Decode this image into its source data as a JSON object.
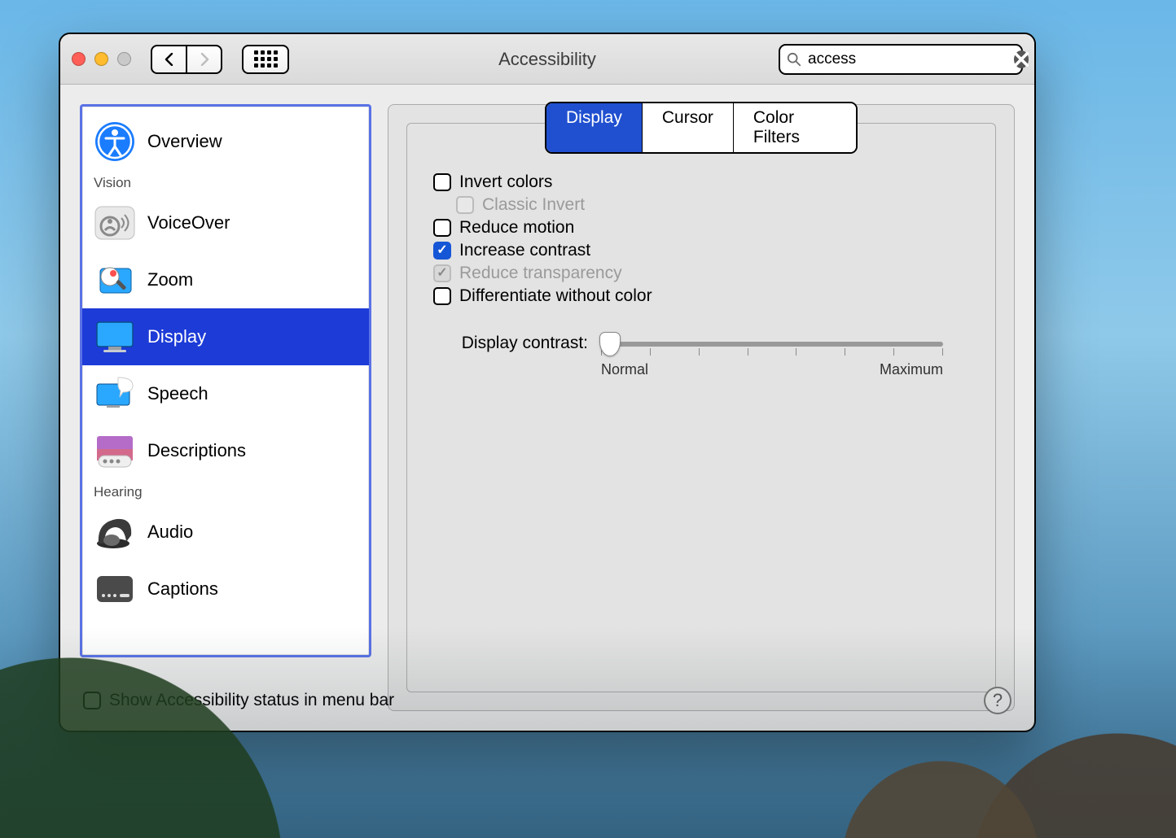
{
  "window": {
    "title": "Accessibility"
  },
  "search": {
    "value": "access",
    "placeholder": "Search"
  },
  "sidebar": {
    "sections": [
      {
        "label": "",
        "items": [
          {
            "id": "overview",
            "label": "Overview",
            "selected": false
          }
        ]
      },
      {
        "label": "Vision",
        "items": [
          {
            "id": "voiceover",
            "label": "VoiceOver",
            "selected": false
          },
          {
            "id": "zoom",
            "label": "Zoom",
            "selected": false
          },
          {
            "id": "display",
            "label": "Display",
            "selected": true
          },
          {
            "id": "speech",
            "label": "Speech",
            "selected": false
          },
          {
            "id": "descriptions",
            "label": "Descriptions",
            "selected": false
          }
        ]
      },
      {
        "label": "Hearing",
        "items": [
          {
            "id": "audio",
            "label": "Audio",
            "selected": false
          },
          {
            "id": "captions",
            "label": "Captions",
            "selected": false
          }
        ]
      }
    ]
  },
  "tabs": [
    {
      "id": "display",
      "label": "Display",
      "active": true
    },
    {
      "id": "cursor",
      "label": "Cursor",
      "active": false
    },
    {
      "id": "color-filters",
      "label": "Color Filters",
      "active": false
    }
  ],
  "options": {
    "invert_colors": {
      "label": "Invert colors",
      "checked": false,
      "disabled": false
    },
    "classic_invert": {
      "label": "Classic Invert",
      "checked": false,
      "disabled": true
    },
    "reduce_motion": {
      "label": "Reduce motion",
      "checked": false,
      "disabled": false
    },
    "increase_contrast": {
      "label": "Increase contrast",
      "checked": true,
      "disabled": false
    },
    "reduce_transparency": {
      "label": "Reduce transparency",
      "checked": true,
      "disabled": true
    },
    "differentiate_without_color": {
      "label": "Differentiate without color",
      "checked": false,
      "disabled": false
    }
  },
  "slider": {
    "label": "Display contrast:",
    "min_label": "Normal",
    "max_label": "Maximum",
    "value": 0,
    "ticks": 8
  },
  "footer": {
    "menubar_checkbox_label": "Show Accessibility status in menu bar",
    "menubar_checked": false
  }
}
